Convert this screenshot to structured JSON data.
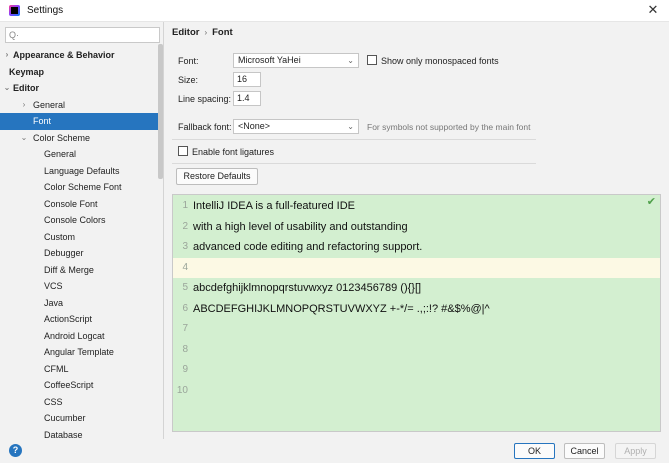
{
  "window": {
    "title": "Settings",
    "close_glyph": "✕"
  },
  "search": {
    "glyph": "Q·",
    "placeholder": ""
  },
  "sidebar": {
    "items": [
      {
        "label": "Appearance & Behavior",
        "arrow": "›",
        "indent": 0,
        "bold": true,
        "selected": false
      },
      {
        "label": "Keymap",
        "arrow": "",
        "indent": 0,
        "bold": true,
        "selected": false
      },
      {
        "label": "Editor",
        "arrow": "⌄",
        "indent": 0,
        "bold": true,
        "selected": false
      },
      {
        "label": "General",
        "arrow": "›",
        "indent": 1,
        "bold": false,
        "selected": false
      },
      {
        "label": "Font",
        "arrow": "",
        "indent": 1,
        "bold": false,
        "selected": true
      },
      {
        "label": "Color Scheme",
        "arrow": "⌄",
        "indent": 1,
        "bold": false,
        "selected": false
      },
      {
        "label": "General",
        "arrow": "",
        "indent": 2,
        "bold": false,
        "selected": false
      },
      {
        "label": "Language Defaults",
        "arrow": "",
        "indent": 2,
        "bold": false,
        "selected": false
      },
      {
        "label": "Color Scheme Font",
        "arrow": "",
        "indent": 2,
        "bold": false,
        "selected": false
      },
      {
        "label": "Console Font",
        "arrow": "",
        "indent": 2,
        "bold": false,
        "selected": false
      },
      {
        "label": "Console Colors",
        "arrow": "",
        "indent": 2,
        "bold": false,
        "selected": false
      },
      {
        "label": "Custom",
        "arrow": "",
        "indent": 2,
        "bold": false,
        "selected": false
      },
      {
        "label": "Debugger",
        "arrow": "",
        "indent": 2,
        "bold": false,
        "selected": false
      },
      {
        "label": "Diff & Merge",
        "arrow": "",
        "indent": 2,
        "bold": false,
        "selected": false
      },
      {
        "label": "VCS",
        "arrow": "",
        "indent": 2,
        "bold": false,
        "selected": false
      },
      {
        "label": "Java",
        "arrow": "",
        "indent": 2,
        "bold": false,
        "selected": false
      },
      {
        "label": "ActionScript",
        "arrow": "",
        "indent": 2,
        "bold": false,
        "selected": false
      },
      {
        "label": "Android Logcat",
        "arrow": "",
        "indent": 2,
        "bold": false,
        "selected": false
      },
      {
        "label": "Angular Template",
        "arrow": "",
        "indent": 2,
        "bold": false,
        "selected": false
      },
      {
        "label": "CFML",
        "arrow": "",
        "indent": 2,
        "bold": false,
        "selected": false
      },
      {
        "label": "CoffeeScript",
        "arrow": "",
        "indent": 2,
        "bold": false,
        "selected": false
      },
      {
        "label": "CSS",
        "arrow": "",
        "indent": 2,
        "bold": false,
        "selected": false
      },
      {
        "label": "Cucumber",
        "arrow": "",
        "indent": 2,
        "bold": false,
        "selected": false
      },
      {
        "label": "Database",
        "arrow": "",
        "indent": 2,
        "bold": false,
        "selected": false
      }
    ]
  },
  "breadcrumb": {
    "parent": "Editor",
    "separator": "›",
    "current": "Font"
  },
  "form": {
    "font_label": "Font:",
    "font_value": "Microsoft YaHei",
    "mono_label": "Show only monospaced fonts",
    "mono_checked": false,
    "size_label": "Size:",
    "size_value": "16",
    "spacing_label": "Line spacing:",
    "spacing_value": "1.4",
    "fallback_label": "Fallback font:",
    "fallback_value": "<None>",
    "fallback_hint": "For symbols not supported by the main font",
    "ligatures_label": "Enable font ligatures",
    "ligatures_checked": false,
    "restore_label": "Restore Defaults",
    "chevron": "⌄"
  },
  "preview": {
    "status_glyph": "✔",
    "lines": [
      {
        "num": "1",
        "text": "IntelliJ IDEA is a full-featured IDE"
      },
      {
        "num": "2",
        "text": "with a high level of usability and outstanding"
      },
      {
        "num": "3",
        "text": "advanced code editing and refactoring support."
      },
      {
        "num": "4",
        "text": ""
      },
      {
        "num": "5",
        "text": "abcdefghijklmnopqrstuvwxyz 0123456789 (){}[]"
      },
      {
        "num": "6",
        "text": "ABCDEFGHIJKLMNOPQRSTUVWXYZ +-*/= .,;:!? #&$%@|^"
      },
      {
        "num": "7",
        "text": ""
      },
      {
        "num": "8",
        "text": ""
      },
      {
        "num": "9",
        "text": ""
      },
      {
        "num": "10",
        "text": ""
      }
    ],
    "current_line": "4"
  },
  "footer": {
    "help_glyph": "?",
    "ok": "OK",
    "cancel": "Cancel",
    "apply": "Apply"
  }
}
